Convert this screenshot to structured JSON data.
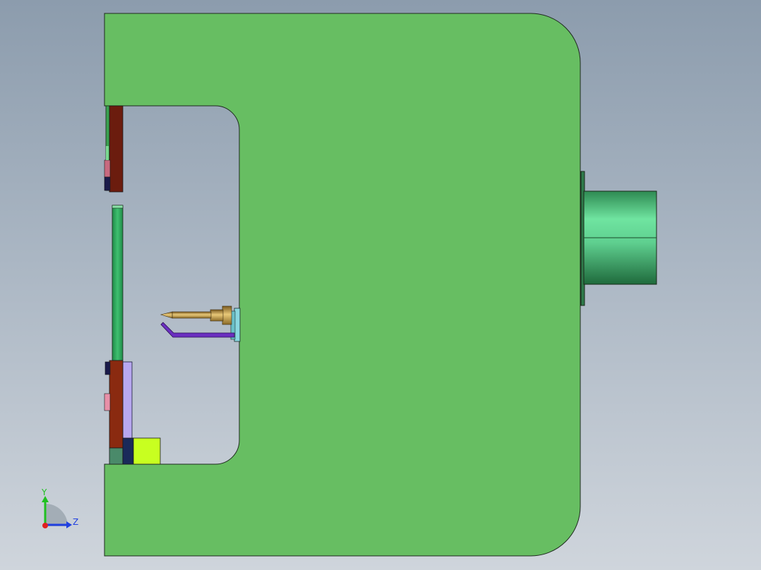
{
  "viewport": {
    "background_top": "#8c9cad",
    "background_bottom": "#cfd5dc"
  },
  "model": {
    "frame_color": "#67be62",
    "frame_edge_color": "#1e2a1e",
    "cylinder_light": "#6fe4a0",
    "cylinder_dark": "#2e8a52",
    "tool_tip_color": "#c8a24a",
    "wire_color": "#6a2fc0",
    "mount_block_color": "#8ad8e0",
    "bracket_dark_red": "#6b1c0e",
    "bracket_red": "#8a2a10",
    "strip_green": "#2faa5a",
    "lavender_block": "#b8a8f0",
    "pink_pad": "#e890a8",
    "navy_block": "#1a2a5a",
    "lime_block": "#c8ff20",
    "teal_block": "#4a8a6a"
  },
  "triad": {
    "y_label": "Y",
    "z_label": "Z",
    "y_color": "#20c020",
    "z_color": "#2040e0",
    "origin_color": "#e02020",
    "icon": "coordinate-triad-icon"
  }
}
